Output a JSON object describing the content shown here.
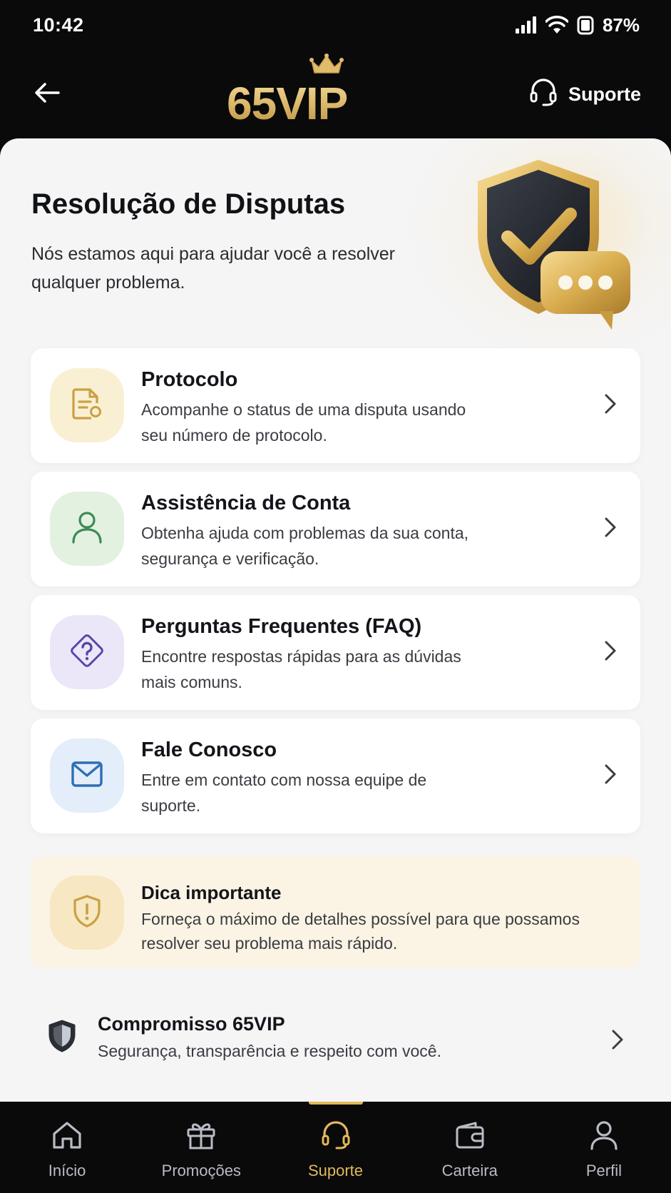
{
  "status_bar": {
    "time": "10:42",
    "battery": "87%",
    "icons": [
      "signal-icon",
      "wifi-icon",
      "battery-icon"
    ]
  },
  "header": {
    "logo_text": "65VIP",
    "support_label": "Suporte",
    "icons": [
      "back-arrow-icon",
      "crown-icon",
      "headset-icon"
    ]
  },
  "hero": {
    "title": "Resolução de Disputas",
    "subtitle": "Nós estamos aqui para ajudar você a resolver qualquer problema.",
    "illustration": "shield-check-chat-illustration"
  },
  "options": [
    {
      "title": "Protocolo",
      "description": "Acompanhe o status de uma disputa usando seu número de protocolo.",
      "icon": "document-search-icon",
      "icon_color": "#c9a043",
      "bubble_color": "#f9efd3"
    },
    {
      "title": "Assistência de Conta",
      "description": "Obtenha ajuda com problemas da sua conta, segurança e verificação.",
      "icon": "user-icon",
      "icon_color": "#3f8a55",
      "bubble_color": "#e3f1e1"
    },
    {
      "title": "Perguntas Frequentes (FAQ)",
      "description": "Encontre respostas rápidas para as dúvidas mais comuns.",
      "icon": "question-icon",
      "icon_color": "#5646a8",
      "bubble_color": "#ebe7f8"
    },
    {
      "title": "Fale Conosco",
      "description": "Entre em contato com nossa equipe de suporte.",
      "icon": "mail-icon",
      "icon_color": "#2f6eb5",
      "bubble_color": "#e3eefa"
    }
  ],
  "tip": {
    "title": "Dica importante",
    "description": "Forneça o máximo de detalhes possível para que possamos resolver seu problema mais rápido.",
    "icon": "shield-alert-icon"
  },
  "commitment": {
    "title": "Compromisso 65VIP",
    "description": "Segurança, transparência e respeito com você.",
    "icon": "shield-icon"
  },
  "bottom_nav": [
    {
      "label": "Início",
      "icon": "home-icon",
      "active": false
    },
    {
      "label": "Promoções",
      "icon": "gift-icon",
      "active": false
    },
    {
      "label": "Suporte",
      "icon": "headset-icon",
      "active": true
    },
    {
      "label": "Carteira",
      "icon": "wallet-icon",
      "active": false
    },
    {
      "label": "Perfil",
      "icon": "profile-icon",
      "active": false
    }
  ],
  "colors": {
    "accent_gold": "#e2b95a",
    "background": "#f5f5f6",
    "dark": "#0a0a0b"
  }
}
